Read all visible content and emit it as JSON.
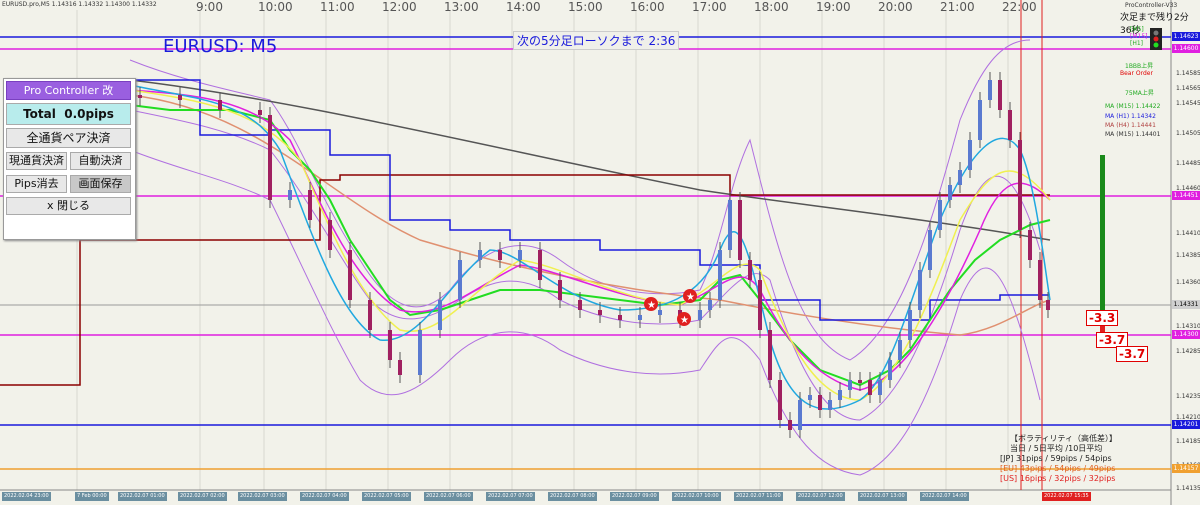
{
  "chart_header": {
    "symbol_info": "EURUSD.pro,M5  1.14316 1.14332 1.14300 1.14332"
  },
  "symbol_title": "EURUSD: M5",
  "countdown_text": "次の5分足ローソクまで 2:36",
  "next_bar_text": "次足まで残り2分36秒",
  "version_text": "ProController-V33",
  "time_labels": [
    "9:00",
    "10:00",
    "11:00",
    "12:00",
    "13:00",
    "14:00",
    "15:00",
    "16:00",
    "17:00",
    "18:00",
    "19:00",
    "20:00",
    "21:00",
    "22:00"
  ],
  "price_ticks": [
    "1.14585",
    "1.14565",
    "1.14545",
    "1.14505",
    "1.14485",
    "1.14460",
    "1.14410",
    "1.14385",
    "1.14360",
    "1.14310",
    "1.14285",
    "1.14235",
    "1.14210",
    "1.14185",
    "1.14160",
    "1.14135"
  ],
  "price_tags": [
    {
      "label": "1.14623",
      "bg": "#1a1adc",
      "fg": "#ffffff"
    },
    {
      "label": "1.14600",
      "bg": "#e020e0",
      "fg": "#ffffff"
    },
    {
      "label": "1.14451",
      "bg": "#e020e0",
      "fg": "#ffffff"
    },
    {
      "label": "1.14331",
      "bg": "#cfcfcf",
      "fg": "#000000"
    },
    {
      "label": "1.14300",
      "bg": "#e020e0",
      "fg": "#ffffff"
    },
    {
      "label": "1.14201",
      "bg": "#1a1adc",
      "fg": "#ffffff"
    },
    {
      "label": "1.14157",
      "bg": "#f0a030",
      "fg": "#ffffff"
    }
  ],
  "ma_labels": [
    {
      "text": "[M5]",
      "color": "#22aa22"
    },
    {
      "text": "[M15]",
      "color": "#e020e0"
    },
    {
      "text": "[H1]",
      "color": "#22aa22"
    },
    {
      "text": "1BBB上昇",
      "color": "#22aa22"
    },
    {
      "text": "Bear Order",
      "color": "#e00000"
    },
    {
      "text": "75MA上昇",
      "color": "#22aa22"
    },
    {
      "text": "MA (M15) 1.14422",
      "color": "#22aa22"
    },
    {
      "text": "MA (H1) 1.14342",
      "color": "#1a1adc"
    },
    {
      "text": "MA (H4) 1.14441",
      "color": "#b04040"
    },
    {
      "text": "MA (M15) 1.14401",
      "color": "#333333"
    }
  ],
  "pro_controller": {
    "title": "Pro Controller 改",
    "total_label": "Total",
    "total_value": "0.0pips",
    "close_all_pairs": "全通貨ペア決済",
    "close_current": "現通貨決済",
    "auto_close": "自動決済",
    "clear_pips": "Pips消去",
    "save_screen": "画面保存",
    "close_panel": "x 閉じる"
  },
  "pip_boxes": [
    "-3.3",
    "-3.7",
    "-3.7"
  ],
  "volatility": {
    "title": "【ボラティリティ（高低差）】",
    "header": "当日 / 5日平均 /10日平均",
    "rows": [
      {
        "label": "[JP]",
        "text": "31pips /  59pips /  54pips",
        "color": "#222222"
      },
      {
        "label": "[EU]",
        "text": "43pips /  54pips /  49pips",
        "color": "#e06020"
      },
      {
        "label": "[US]",
        "text": "16pips /  32pips /  32pips",
        "color": "#e02020"
      }
    ]
  },
  "date_tags": [
    "2022.02.04 23:00",
    "7 Feb 00:00",
    "2022.02.07 01:00",
    "2022.02.07 02:00",
    "2022.02.07 03:00",
    "2022.02.07 04:00",
    "2022.02.07 05:00",
    "2022.02.07 06:00",
    "2022.02.07 07:00",
    "2022.02.07 08:00",
    "2022.02.07 09:00",
    "2022.02.07 10:00",
    "2022.02.07 11:00",
    "2022.02.07 12:00",
    "2022.02.07 13:00",
    "2022.02.07 14:00",
    "2022.02.07 15:35"
  ],
  "colors": {
    "bg": "#f2f2ea",
    "bull": "#5a7ad0",
    "bear": "#a02060",
    "blue_line": "#1a1adc",
    "magenta": "#e020e0",
    "darkred": "#8b0000",
    "gray": "#555555"
  }
}
